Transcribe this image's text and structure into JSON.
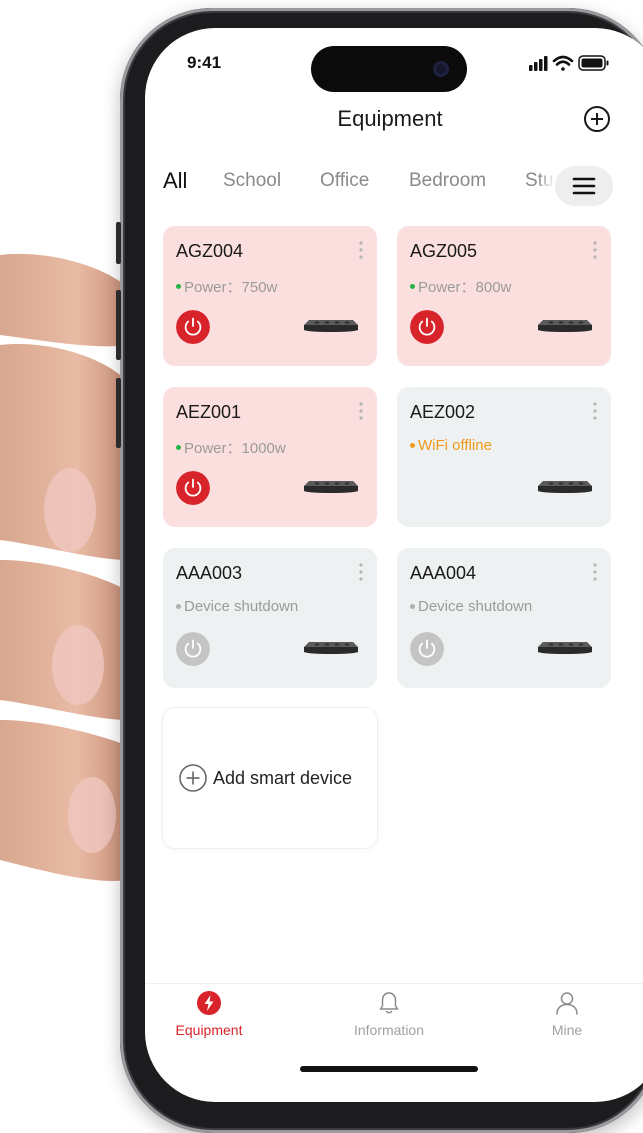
{
  "status_bar": {
    "time": "9:41"
  },
  "header": {
    "title": "Equipment"
  },
  "tabs": [
    {
      "label": "All",
      "active": true
    },
    {
      "label": "School",
      "active": false
    },
    {
      "label": "Office",
      "active": false
    },
    {
      "label": "Bedroom",
      "active": false
    },
    {
      "label": "Stu",
      "active": false
    }
  ],
  "devices": [
    {
      "name": "AGZ004",
      "status": "Power：750w",
      "state": "on"
    },
    {
      "name": "AGZ005",
      "status": "Power：800w",
      "state": "on"
    },
    {
      "name": "AEZ001",
      "status": "Power：1000w",
      "state": "on"
    },
    {
      "name": "AEZ002",
      "status": "WiFi offline",
      "state": "offline"
    },
    {
      "name": "AAA003",
      "status": "Device shutdown",
      "state": "shutdown"
    },
    {
      "name": "AAA004",
      "status": "Device shutdown",
      "state": "shutdown"
    }
  ],
  "add_device": {
    "label": "Add smart device"
  },
  "bottom_nav": [
    {
      "label": "Equipment",
      "active": true
    },
    {
      "label": "Information",
      "active": false
    },
    {
      "label": "Mine",
      "active": false
    }
  ],
  "colors": {
    "accent_red": "#d9232a",
    "power_green": "#27b34a",
    "offline_orange": "#f09a1c",
    "card_on_bg": "#fbdede",
    "card_off_bg": "#eef1f2"
  }
}
